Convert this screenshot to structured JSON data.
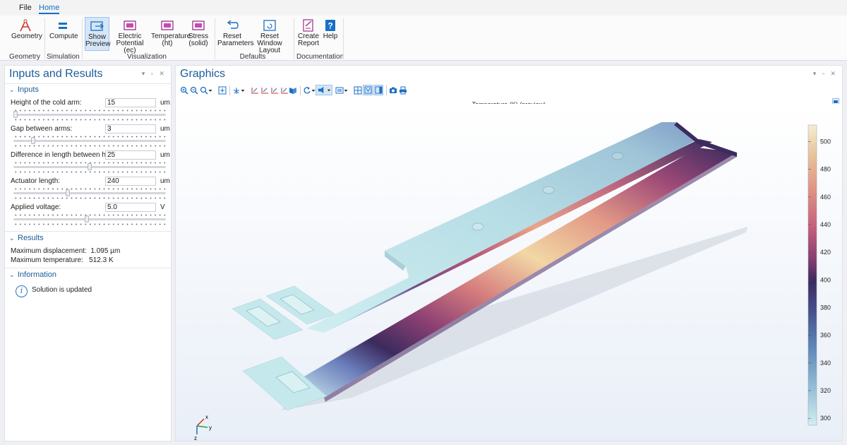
{
  "menubar": {
    "tabs": [
      "File",
      "Home"
    ]
  },
  "ribbon": {
    "geometry": {
      "label": "Geometry"
    },
    "compute": {
      "label": "Compute"
    },
    "show_preview": {
      "line1": "Show",
      "line2": "Preview"
    },
    "electric": {
      "line1": "Electric",
      "line2": "Potential (ec)"
    },
    "temperature": {
      "line1": "Temperature",
      "line2": "(ht)"
    },
    "stress": {
      "line1": "Stress",
      "line2": "(solid)"
    },
    "reset_params": {
      "line1": "Reset",
      "line2": "Parameters"
    },
    "reset_window": {
      "line1": "Reset Window",
      "line2": "Layout"
    },
    "create_report": {
      "line1": "Create",
      "line2": "Report"
    },
    "help": {
      "label": "Help"
    },
    "groups": [
      "Geometry",
      "Simulation",
      "Visualization",
      "Defaults",
      "Documentation"
    ]
  },
  "left_panel": {
    "title": "Inputs and Results",
    "inputs_header": "Inputs",
    "params": [
      {
        "label": "Height of the cold arm:",
        "value": "15",
        "unit": "um",
        "slider": 0.0
      },
      {
        "label": "Gap between arms:",
        "value": "3",
        "unit": "um",
        "slider": 0.12
      },
      {
        "label": "Difference in length between hot arms:",
        "value": "25",
        "unit": "um",
        "slider": 0.5
      },
      {
        "label": "Actuator length:",
        "value": "240",
        "unit": "um",
        "slider": 0.35
      },
      {
        "label": "Applied voltage:",
        "value": "5.0",
        "unit": "V",
        "slider": 0.48
      }
    ],
    "results_header": "Results",
    "results": [
      {
        "label": "Maximum displacement:",
        "value": "1.095 µm"
      },
      {
        "label": "Maximum temperature:",
        "value": "512.3 K"
      }
    ],
    "info_header": "Information",
    "info_text": "Solution is updated"
  },
  "graphics": {
    "title": "Graphics",
    "plot_title": "Temperature (K) (preview)",
    "colorbar_ticks": [
      "500",
      "480",
      "460",
      "440",
      "420",
      "400",
      "380",
      "360",
      "340",
      "320",
      "300"
    ],
    "colorbar_range": [
      295,
      512
    ],
    "axis_labels": {
      "x": "x",
      "y": "y",
      "z": "z"
    }
  },
  "colors": {
    "accent": "#1a6fc4",
    "title_blue": "#1b5c99"
  }
}
